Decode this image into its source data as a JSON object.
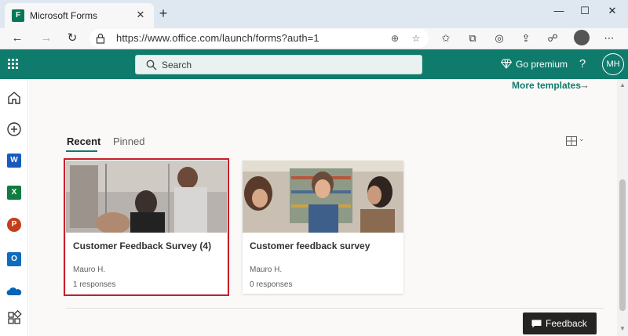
{
  "browser": {
    "tab_title": "Microsoft Forms",
    "tab_close": "✕",
    "new_tab": "+",
    "url": "https://www.office.com/launch/forms?auth=1",
    "window_controls": {
      "minimize": "—",
      "maximize": "☐",
      "close": "✕"
    }
  },
  "header": {
    "search_placeholder": "Search",
    "premium_label": "Go premium",
    "help": "?",
    "avatar_initials": "MH"
  },
  "rail": {
    "items": [
      {
        "icon": "home-icon"
      },
      {
        "icon": "create-icon"
      },
      {
        "icon": "word-icon",
        "letter": "W",
        "color": "#185abd"
      },
      {
        "icon": "excel-icon",
        "letter": "X",
        "color": "#107c41"
      },
      {
        "icon": "powerpoint-icon",
        "letter": "P",
        "color": "#c43e1c"
      },
      {
        "icon": "outlook-icon",
        "letter": "O",
        "color": "#0f6cbd"
      },
      {
        "icon": "onedrive-icon",
        "color": "#0364b8"
      },
      {
        "icon": "all-apps-icon"
      }
    ]
  },
  "main": {
    "more_templates": "More templates",
    "tabs": {
      "recent": "Recent",
      "pinned": "Pinned"
    },
    "cards": [
      {
        "title": "Customer Feedback Survey (4)",
        "author": "Mauro H.",
        "responses": "1 responses",
        "selected": true
      },
      {
        "title": "Customer feedback survey",
        "author": "Mauro H.",
        "responses": "0 responses",
        "selected": false
      }
    ]
  },
  "feedback_label": "Feedback",
  "colors": {
    "brand": "#0f7b6c",
    "selection": "#c8202b",
    "feedback_bg": "#252423"
  }
}
